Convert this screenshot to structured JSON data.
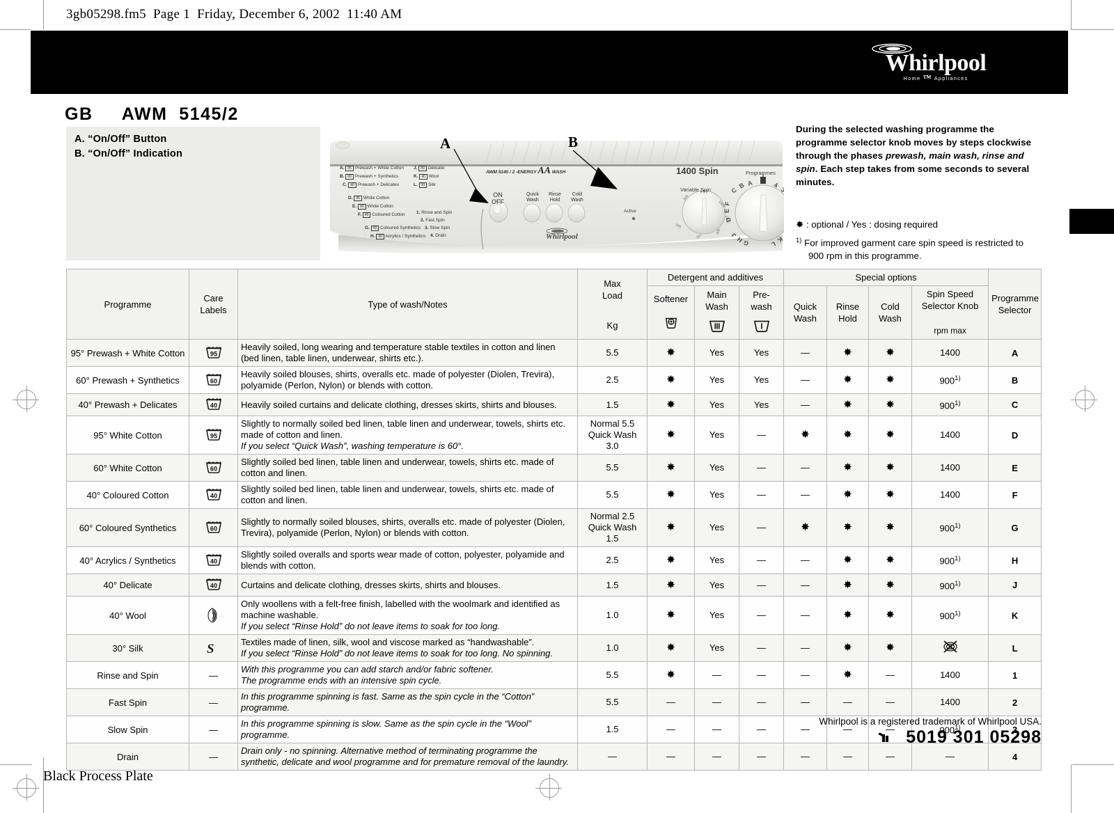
{
  "page_header": "3gb05298.fm5  Page 1  Friday, December 6, 2002  11:40 AM",
  "brand": {
    "name": "Whirlpool",
    "tagline_left": "Home",
    "tagline_right": "Appliances"
  },
  "model_title": "GB     AWM  5145/2",
  "legend": {
    "a": "A. “On/Off” Button",
    "b": "B. “On/Off” Indication"
  },
  "callouts": {
    "a": "A",
    "b": "B"
  },
  "note": {
    "paragraph_1": "During the selected washing programme the programme selector knob moves by steps clockwise through the phases ",
    "paragraph_1_italic": "prewash, main wash, rinse and spin",
    "paragraph_1_end": ". Each step takes from some seconds to several minutes.",
    "optional_line": "✸ : optional / Yes : dosing required",
    "footnote_marker": "1)",
    "footnote_line_1": "For improved garment care spin speed is restricted to",
    "footnote_line_2": "900 rpm in this programme."
  },
  "panel": {
    "model_text": "AWM 5145 / 2",
    "energy_text": "-ENERGY",
    "energy_aa": "AA",
    "wash_text": "WASH",
    "active_label": "Active",
    "on_off": [
      "ON",
      "OFF"
    ],
    "buttons": [
      {
        "line1": "Quick",
        "line2": "Wash"
      },
      {
        "line1": "Rinse",
        "line2": "Hold"
      },
      {
        "line1": "Cold",
        "line2": "Wash"
      }
    ],
    "spin_title": "1400 Spin",
    "variable_spin": "Variable Spin",
    "programmes_label": "Programmes",
    "spin_ticks": [
      "500",
      "700",
      "900",
      "1000",
      "1200",
      "1400"
    ],
    "selector_left": [
      "F",
      "E",
      "D",
      "J",
      "H",
      "G"
    ],
    "selector_top": [
      "C",
      "B",
      "A"
    ],
    "selector_right": [
      "4",
      "3",
      "2",
      "1",
      "L",
      "K"
    ],
    "brand_small": "Whirlpool",
    "left_list": [
      {
        "key": "A.",
        "temp": "95",
        "text": "Prewash + White Cotton"
      },
      {
        "key": "B.",
        "temp": "60",
        "text": "Prewash + Synthetics"
      },
      {
        "key": "C.",
        "temp": "40",
        "text": "Prewash + Delicates"
      },
      {
        "key": "D.",
        "temp": "95",
        "text": "White Cotton"
      },
      {
        "key": "E.",
        "temp": "60",
        "text": "White Cotton"
      },
      {
        "key": "F.",
        "temp": "40",
        "text": "Coloured Cotton"
      },
      {
        "key": "G.",
        "temp": "60",
        "text": "Coloured Synthetics"
      },
      {
        "key": "H.",
        "temp": "40",
        "text": "Acrylics / Synthetics"
      }
    ],
    "mid_list": [
      {
        "key": "J.",
        "temp": "40",
        "text": "Delicate"
      },
      {
        "key": "K.",
        "temp": "40",
        "text": "Wool"
      },
      {
        "key": "L.",
        "temp": "30",
        "text": "Silk"
      }
    ],
    "num_list": [
      {
        "key": "1.",
        "text": "Rinse and Spin"
      },
      {
        "key": "2.",
        "text": "Fast Spin"
      },
      {
        "key": "3.",
        "text": "Slow Spin"
      },
      {
        "key": "4.",
        "text": "Drain"
      }
    ]
  },
  "table": {
    "headers": {
      "programme": "Programme",
      "care_labels_l1": "Care",
      "care_labels_l2": "Labels",
      "type_of_wash": "Type of wash/Notes",
      "max_load_l1": "Max",
      "max_load_l2": "Load",
      "max_load_unit": "Kg",
      "detergent_group": "Detergent and additives",
      "special_group": "Special options",
      "softener": "Softener",
      "main_wash_l1": "Main",
      "main_wash_l2": "Wash",
      "prewash_l1": "Pre-",
      "prewash_l2": "wash",
      "quick_wash_l1": "Quick",
      "quick_wash_l2": "Wash",
      "rinse_hold_l1": "Rinse",
      "rinse_hold_l2": "Hold",
      "cold_wash": "Cold Wash",
      "spin_speed_l1": "Spin Speed",
      "spin_speed_l2": "Selector Knob",
      "spin_speed_unit": "rpm max",
      "prog_selector_l1": "Programme",
      "prog_selector_l2": "Selector"
    },
    "rows": [
      {
        "programme": "95° Prewash + White Cotton",
        "care": "95",
        "notes": "Heavily soiled, long wearing and temperature stable textiles in cotton and linen (bed linen, table linen, underwear, shirts etc.).",
        "notes_italic": "",
        "load": "5.5",
        "softener": "✸",
        "main_wash": "Yes",
        "prewash": "Yes",
        "quick_wash": "—",
        "rinse_hold": "✸",
        "cold_wash": "✸",
        "spin": "1400",
        "spin_note": "",
        "selector": "A"
      },
      {
        "programme": "60° Prewash + Synthetics",
        "care": "60",
        "notes": "Heavily soiled blouses, shirts, overalls etc. made of polyester (Diolen, Trevira), polyamide (Perlon, Nylon) or blends with cotton.",
        "notes_italic": "",
        "load": "2.5",
        "softener": "✸",
        "main_wash": "Yes",
        "prewash": "Yes",
        "quick_wash": "—",
        "rinse_hold": "✸",
        "cold_wash": "✸",
        "spin": "900",
        "spin_note": "1)",
        "selector": "B"
      },
      {
        "programme": "40° Prewash + Delicates",
        "care": "40",
        "notes": "Heavily soiled curtains and delicate clothing, dresses skirts, shirts and blouses.",
        "notes_italic": "",
        "load": "1.5",
        "softener": "✸",
        "main_wash": "Yes",
        "prewash": "Yes",
        "quick_wash": "—",
        "rinse_hold": "✸",
        "cold_wash": "✸",
        "spin": "900",
        "spin_note": "1)",
        "selector": "C"
      },
      {
        "programme": "95° White Cotton",
        "care": "95",
        "notes": "Slightly to normally soiled bed linen, table linen and underwear, towels, shirts etc. made of cotton and linen.",
        "notes_italic": "If you select “Quick Wash”, washing temperature is 60°.",
        "load": "Normal 5.5\nQuick Wash 3.0",
        "softener": "✸",
        "main_wash": "Yes",
        "prewash": "—",
        "quick_wash": "✸",
        "rinse_hold": "✸",
        "cold_wash": "✸",
        "spin": "1400",
        "spin_note": "",
        "selector": "D"
      },
      {
        "programme": "60° White Cotton",
        "care": "60",
        "notes": "Slightly soiled bed linen, table linen and underwear, towels, shirts etc. made of cotton and linen.",
        "notes_italic": "",
        "load": "5.5",
        "softener": "✸",
        "main_wash": "Yes",
        "prewash": "—",
        "quick_wash": "—",
        "rinse_hold": "✸",
        "cold_wash": "✸",
        "spin": "1400",
        "spin_note": "",
        "selector": "E"
      },
      {
        "programme": "40° Coloured Cotton",
        "care": "40",
        "notes": "Slightly soiled bed linen, table linen and underwear, towels, shirts etc. made of cotton and linen.",
        "notes_italic": "",
        "load": "5.5",
        "softener": "✸",
        "main_wash": "Yes",
        "prewash": "—",
        "quick_wash": "—",
        "rinse_hold": "✸",
        "cold_wash": "✸",
        "spin": "1400",
        "spin_note": "",
        "selector": "F"
      },
      {
        "programme": "60° Coloured Synthetics",
        "care": "60",
        "notes": "Slightly to normally soiled blouses, shirts, overalls etc. made of polyester (Diolen, Trevira), polyamide (Perlon, Nylon) or blends with cotton.",
        "notes_italic": "",
        "load": "Normal 2.5\nQuick Wash 1.5",
        "softener": "✸",
        "main_wash": "Yes",
        "prewash": "—",
        "quick_wash": "✸",
        "rinse_hold": "✸",
        "cold_wash": "✸",
        "spin": "900",
        "spin_note": "1)",
        "selector": "G"
      },
      {
        "programme": "40° Acrylics / Synthetics",
        "care": "40",
        "notes": "Slightly soiled overalls and sports wear made of cotton, polyester, polyamide and blends with cotton.",
        "notes_italic": "",
        "load": "2.5",
        "softener": "✸",
        "main_wash": "Yes",
        "prewash": "—",
        "quick_wash": "—",
        "rinse_hold": "✸",
        "cold_wash": "✸",
        "spin": "900",
        "spin_note": "1)",
        "selector": "H"
      },
      {
        "programme": "40° Delicate",
        "care": "40",
        "notes": "Curtains and delicate clothing, dresses skirts, shirts and blouses.",
        "notes_italic": "",
        "load": "1.5",
        "softener": "✸",
        "main_wash": "Yes",
        "prewash": "—",
        "quick_wash": "—",
        "rinse_hold": "✸",
        "cold_wash": "✸",
        "spin": "900",
        "spin_note": "1)",
        "selector": "J"
      },
      {
        "programme": "40° Wool",
        "care": "wool",
        "notes": "Only woollens with a felt-free finish, labelled with the woolmark and identified as machine washable.",
        "notes_italic": "If you select “Rinse Hold” do not leave items to soak for too long.",
        "load": "1.0",
        "softener": "✸",
        "main_wash": "Yes",
        "prewash": "—",
        "quick_wash": "—",
        "rinse_hold": "✸",
        "cold_wash": "✸",
        "spin": "900",
        "spin_note": "1)",
        "selector": "K"
      },
      {
        "programme": "30° Silk",
        "care": "silk",
        "notes": "Textiles made of linen, silk, wool and viscose marked as “handwashable”.",
        "notes_italic": "If you select “Rinse Hold” do not leave items to soak for too long. No spinning.",
        "load": "1.0",
        "softener": "✸",
        "main_wash": "Yes",
        "prewash": "—",
        "quick_wash": "—",
        "rinse_hold": "✸",
        "cold_wash": "✸",
        "spin": "no-spin-icon",
        "spin_note": "",
        "selector": "L"
      },
      {
        "programme": "Rinse and Spin",
        "care": "—",
        "notes": "",
        "notes_italic": "With this programme you can add starch and/or fabric softener.\nThe programme ends with an intensive spin cycle.",
        "load": "5.5",
        "softener": "✸",
        "main_wash": "—",
        "prewash": "—",
        "quick_wash": "—",
        "rinse_hold": "✸",
        "cold_wash": "—",
        "spin": "1400",
        "spin_note": "",
        "selector": "1"
      },
      {
        "programme": "Fast Spin",
        "care": "—",
        "notes": "",
        "notes_italic": "In this programme spinning is fast. Same as the spin cycle in the “Cotton” programme.",
        "load": "5.5",
        "softener": "—",
        "main_wash": "—",
        "prewash": "—",
        "quick_wash": "—",
        "rinse_hold": "—",
        "cold_wash": "—",
        "spin": "1400",
        "spin_note": "",
        "selector": "2"
      },
      {
        "programme": "Slow Spin",
        "care": "—",
        "notes": "",
        "notes_italic": "In this programme spinning is slow. Same as the spin cycle in the “Wool” programme.",
        "load": "1.5",
        "softener": "—",
        "main_wash": "—",
        "prewash": "—",
        "quick_wash": "—",
        "rinse_hold": "—",
        "cold_wash": "—",
        "spin": "900",
        "spin_note": "1)",
        "selector": "3"
      },
      {
        "programme": "Drain",
        "care": "—",
        "notes": "",
        "notes_italic": "Drain only - no spinning. Alternative method of terminating programme the synthetic, delicate and wool programme and for premature removal of the laundry.",
        "load": "—",
        "softener": "—",
        "main_wash": "—",
        "prewash": "—",
        "quick_wash": "—",
        "rinse_hold": "—",
        "cold_wash": "—",
        "spin": "—",
        "spin_note": "",
        "selector": "4"
      }
    ]
  },
  "footer": {
    "trademark": "Whirlpool is a registered trademark of Whirlpool USA.",
    "code": "5019 301 05298",
    "black_process_plate": "Black Process Plate"
  }
}
